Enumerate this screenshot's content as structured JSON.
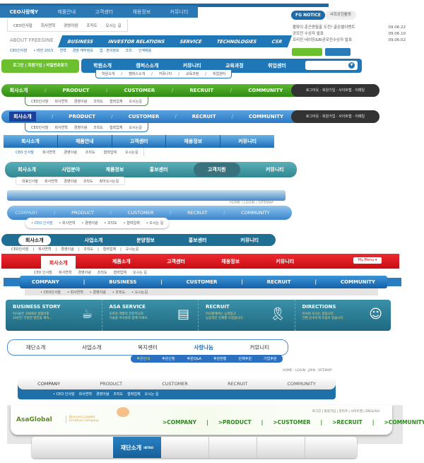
{
  "nav1": {
    "items": [
      "CEO사랑해Y",
      "제품안내",
      "고객센터",
      "채용정보",
      "커뮤니티"
    ],
    "sub": [
      "CEO인사말",
      "회사연혁",
      "경영이념",
      "조직도",
      "오시는 길"
    ]
  },
  "notice": {
    "tab": "FG NOTICE",
    "tab2": "사회공헌활동",
    "items": [
      {
        "t": "볼맞이 춘곤증탈출 도전! 골든벨이벤트",
        "d": "09.06.22"
      },
      {
        "t": "공모전 수상자 발표",
        "d": "09.06.10"
      },
      {
        "t": "프리진 네이밍&BI공모전수상자 발표",
        "d": "09.06.02"
      }
    ]
  },
  "nav2": {
    "label": "ABOUT FREEGINE",
    "items": [
      "BUSINESS",
      "INVESTOR RELATIONS",
      "SERVICE",
      "TECHNOLOGIES",
      "CSR"
    ],
    "sub": [
      "CEO인사말",
      "• 비전 2015",
      "연혁",
      "경영 재무정보",
      "업 · 편의정보",
      "조직",
      "인재채용"
    ]
  },
  "nav3": {
    "login": "로그인 | 회원가입 | 비밀번호찾기",
    "items": [
      "학원소개",
      "캠퍼스소개",
      "커뮤니티",
      "교육과정",
      "취업센터"
    ],
    "sub": [
      "학원소개",
      "캠퍼스소개",
      "커뮤니티",
      "교육과정",
      "취업센터"
    ]
  },
  "nav4": {
    "items": [
      "회사소개",
      "PRODUCT",
      "CUSTOMER",
      "RECRUIT",
      "COMMUNITY"
    ],
    "util": "로그아웃 · 회원가입 · 사이트맵 · 이메일",
    "sub": [
      "CEO인사말",
      "회사연혁",
      "경영이념",
      "조직도",
      "협력업체",
      "오시는길"
    ]
  },
  "nav6": {
    "items": [
      "회사소개",
      "제품안내",
      "고객센터",
      "채용정보",
      "커뮤니티"
    ],
    "sub": [
      "CEO 인사말",
      "회사연혁",
      "경영이념",
      "조직도",
      "협력업체",
      "오시는길"
    ]
  },
  "nav7": {
    "items": [
      "회사소개",
      "사업분야",
      "제품정보",
      "홍보센터",
      "고객지원",
      "커뮤니티"
    ],
    "sub": [
      "대표인사말",
      "회사연혁",
      "경영이념",
      "조직도",
      "찾아오시는길"
    ]
  },
  "nav8": {
    "util": "HOME | LOGIN | SITEMAP"
  },
  "nav9": {
    "items": [
      "COMPANY",
      "PRODUCT",
      "CUSTOMER",
      "RECRUIT",
      "COMMUNITY"
    ],
    "sub": [
      "• CEO 인사말",
      "• 회사연혁",
      "• 경영이념",
      "• 조직도",
      "• 협력업체",
      "• 오시는 길"
    ]
  },
  "nav10": {
    "items": [
      "회사소개",
      "사업소개",
      "분양정보",
      "홍보센터",
      "커뮤니티"
    ],
    "sub": [
      "CEO인사말",
      "회사연혁",
      "경영이념",
      "조직도",
      "협력업체",
      "오시는길"
    ]
  },
  "nav11": {
    "items": [
      "회사소개",
      "제품소개",
      "고객센터",
      "채용정보",
      "커뮤니티"
    ],
    "mymenu": "My Menu ▾",
    "sub": [
      "CEO 인사말",
      "회사연혁",
      "경영이념",
      "조직도",
      "협력업체",
      "오시는 길"
    ]
  },
  "nav12": {
    "items": [
      "COMPANY",
      "BUSINESS",
      "CUSTOMER",
      "RECRUIT",
      "COMMUNITY"
    ],
    "sub": [
      "• CEO인사말",
      "• 회사연혁",
      "• 경영이념",
      "• 조직도",
      "• 오시는길"
    ]
  },
  "panel": {
    "sections": [
      {
        "title": "BUSINESS STORY",
        "l1": "아사원은 2000년 설립이후",
        "l2": "10년간 꾸준한 발전을 계속...",
        "icon": "coffee-cup-icon"
      },
      {
        "title": "ASA SERVICE",
        "l1": "모바일 개발의 전문지식과",
        "l2": "기술을 아사원과 함께 하세요.",
        "icon": "notebook-icon"
      },
      {
        "title": "RECRUIT",
        "l1": "아사원에서는 능력있고",
        "l2": "능동적인 인재를 모집합니다.",
        "icon": "award-ribbon-icon"
      },
      {
        "title": "DIRECTIONS",
        "l1": "아사원 오시는 길입니다.",
        "l2": "간편,신속하게 오실수 있습니다.",
        "icon": "support-person-icon"
      }
    ]
  },
  "nav13": {
    "items": [
      "재단소개",
      "사업소개",
      "복지센터",
      "사랑나눔",
      "커뮤니티"
    ],
    "sub": [
      "후원안내",
      "후원신청",
      "후원Q&A",
      "후원현황",
      "단체후원",
      "기업후원"
    ]
  },
  "nav14": {
    "util": "HOME · LOGIN · JOIN · SITEMAP",
    "items": [
      "COMPANY",
      "PRODUCT",
      "CUSTOMER",
      "RECRUIT",
      "COMMUNITY"
    ],
    "sub": [
      "• CEO 인사말",
      "회사연혁",
      "경영이념",
      "조직도",
      "협력업체",
      "오시는 길"
    ]
  },
  "nav15": {
    "logo": "AsaGlobal",
    "tag1": "Business Leader",
    "tag2": "Creative Company",
    "util": "로그인 | 회원가입 | 관리자 | 사이트맵 | ENGLISH",
    "items": [
      ">COMPANY",
      ">PRODUCT",
      ">CUSTOMER",
      ">RECRUIT",
      ">COMMUNITY"
    ]
  },
  "nav16": {
    "active": "재단소개",
    "active_en": "INTRO"
  },
  "colors": {
    "blue": "#1f6fb0",
    "green": "#3f9a1e",
    "teal": "#3a8f98",
    "red": "#d8141c",
    "dark": "#333333"
  }
}
